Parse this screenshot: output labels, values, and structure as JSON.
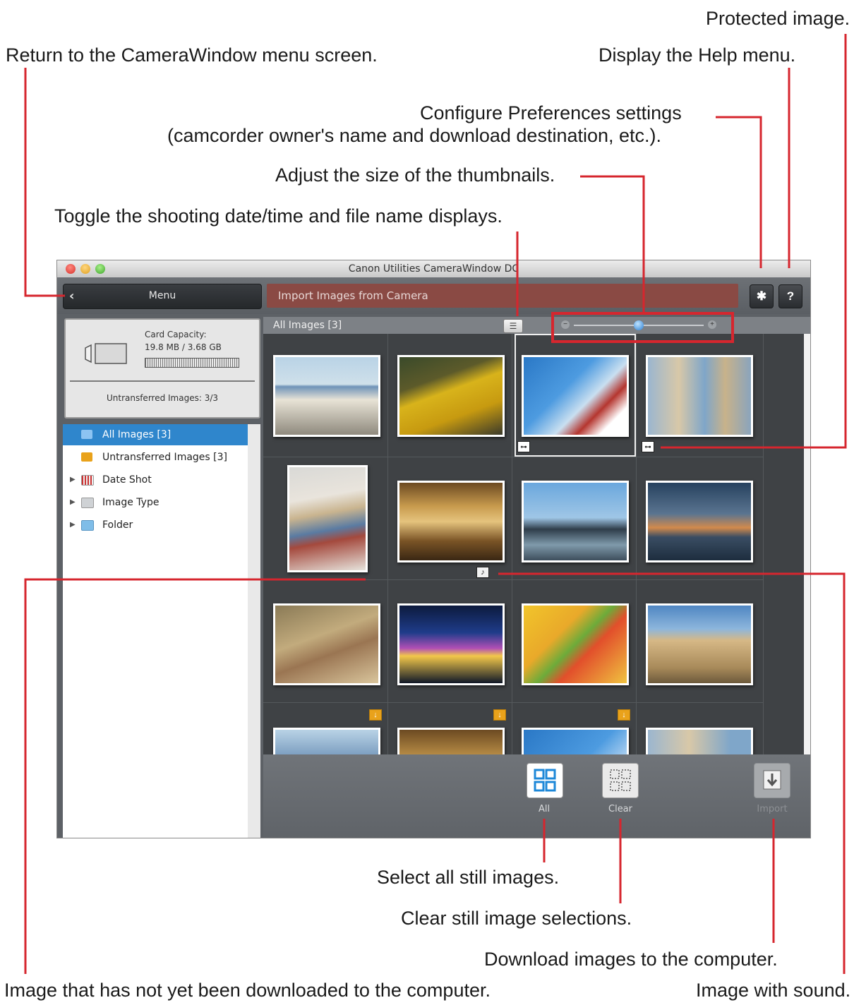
{
  "annotations": {
    "protected": "Protected image.",
    "return_menu": "Return to the CameraWindow menu screen.",
    "help": "Display the Help menu.",
    "prefs_line1": "Configure Preferences settings",
    "prefs_line2": "(camcorder owner's name and download destination, etc.).",
    "thumb_size": "Adjust the size of the thumbnails.",
    "toggle_display": "Toggle the shooting date/time and file name displays.",
    "select_all": "Select all still images.",
    "clear_sel": "Clear still image selections.",
    "download": "Download images to the computer.",
    "not_downloaded": "Image that has not yet been downloaded to the computer.",
    "sound": "Image with sound."
  },
  "window": {
    "title": "Canon Utilities CameraWindow DC",
    "menu_label": "Menu",
    "import_label": "Import Images from Camera",
    "help_label": "?"
  },
  "card": {
    "capacity_label": "Card Capacity:",
    "capacity_value": "19.8 MB / 3.68 GB",
    "untransferred": "Untransferred Images:  3/3"
  },
  "tree": {
    "items": [
      {
        "label": "All Images [3]",
        "selected": true,
        "icon": "photos-icon"
      },
      {
        "label": "Untransferred Images [3]",
        "selected": false,
        "icon": "untransferred-icon"
      },
      {
        "label": "Date Shot",
        "selected": false,
        "icon": "calendar-icon"
      },
      {
        "label": "Image Type",
        "selected": false,
        "icon": "image-type-icon"
      },
      {
        "label": "Folder",
        "selected": false,
        "icon": "folder-icon"
      }
    ]
  },
  "grid": {
    "header": "All Images [3]",
    "thumb_size_level": 0.5
  },
  "bottom": {
    "all_label": "All",
    "clear_label": "Clear",
    "import_label": "Import"
  },
  "colors": {
    "callout_line": "#d6262e",
    "import_bar": "#8a4a44",
    "selection": "#2f86cc"
  }
}
